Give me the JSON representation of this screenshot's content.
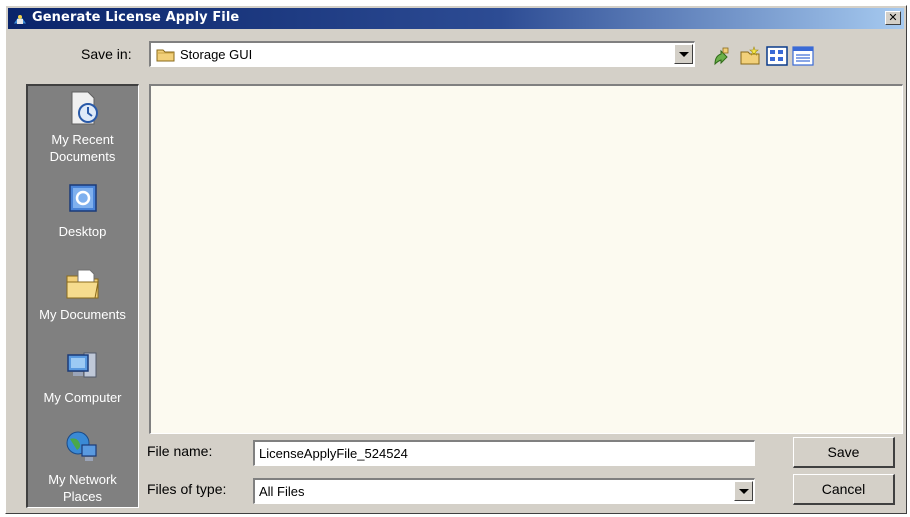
{
  "window": {
    "title": "Generate License Apply File",
    "close_glyph": "✕"
  },
  "save_in": {
    "label": "Save in:",
    "value": "Storage GUI",
    "icon": "folder-icon"
  },
  "toolbar": {
    "icons": [
      "up-one-level-icon",
      "create-new-folder-icon",
      "list-view-icon",
      "details-view-icon"
    ]
  },
  "places": [
    {
      "label": "My Recent Documents",
      "icon": "recent-documents-icon"
    },
    {
      "label": "Desktop",
      "icon": "desktop-icon"
    },
    {
      "label": "My Documents",
      "icon": "my-documents-icon"
    },
    {
      "label": "My Computer",
      "icon": "my-computer-icon"
    },
    {
      "label": "My Network Places",
      "icon": "network-places-icon"
    }
  ],
  "file_list": {
    "items": []
  },
  "file_name": {
    "label": "File name:",
    "value": "LicenseApplyFile_524524"
  },
  "file_type": {
    "label": "Files of type:",
    "value": "All Files"
  },
  "buttons": {
    "save": "Save",
    "cancel": "Cancel"
  },
  "colors": {
    "title_start": "#0a246a",
    "title_end": "#a6caf0",
    "face": "#d4d0c8",
    "places_bg": "#808080",
    "list_bg": "#fcfaf0"
  }
}
